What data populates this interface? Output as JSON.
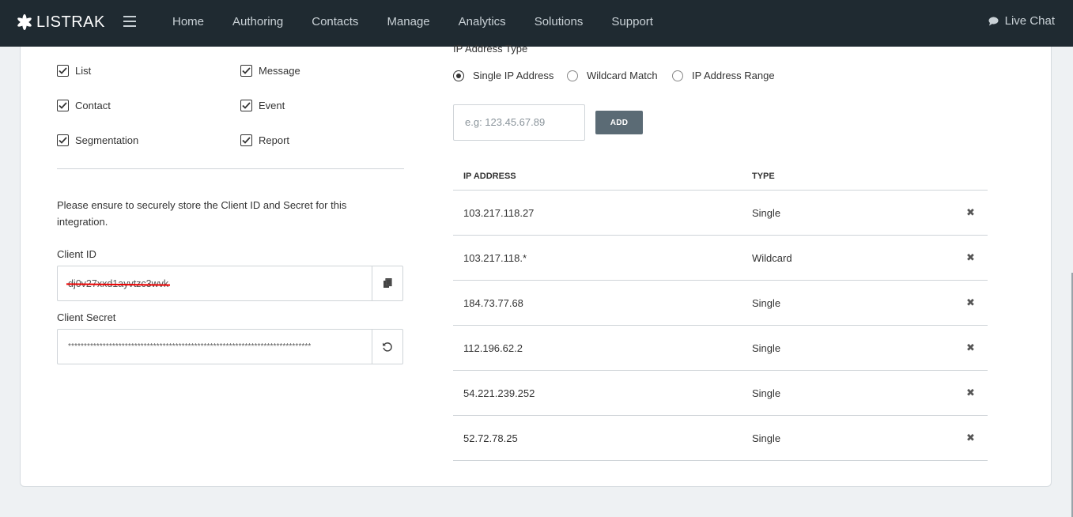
{
  "header": {
    "logo_text": "LISTRAK",
    "nav": [
      "Home",
      "Authoring",
      "Contacts",
      "Manage",
      "Analytics",
      "Solutions",
      "Support"
    ],
    "live_chat": "Live Chat"
  },
  "scopes": [
    {
      "label": "List",
      "checked": true
    },
    {
      "label": "Message",
      "checked": true
    },
    {
      "label": "Contact",
      "checked": true
    },
    {
      "label": "Event",
      "checked": true
    },
    {
      "label": "Segmentation",
      "checked": true
    },
    {
      "label": "Report",
      "checked": true
    }
  ],
  "notice": "Please ensure to securely store the Client ID and Secret for this integration.",
  "client_id": {
    "label": "Client ID",
    "value": "dj0v27xxd1ayvtzc3wvk"
  },
  "client_secret": {
    "label": "Client Secret",
    "value": "*****************************************************************************"
  },
  "ip": {
    "type_label": "IP Address Type",
    "options": [
      {
        "label": "Single IP Address",
        "selected": true
      },
      {
        "label": "Wildcard Match",
        "selected": false
      },
      {
        "label": "IP Address Range",
        "selected": false
      }
    ],
    "input_placeholder": "e.g: 123.45.67.89",
    "add_label": "ADD",
    "columns": [
      "IP ADDRESS",
      "TYPE"
    ],
    "rows": [
      {
        "address": "103.217.118.27",
        "type": "Single"
      },
      {
        "address": "103.217.118.*",
        "type": "Wildcard"
      },
      {
        "address": "184.73.77.68",
        "type": "Single"
      },
      {
        "address": "112.196.62.2",
        "type": "Single"
      },
      {
        "address": "54.221.239.252",
        "type": "Single"
      },
      {
        "address": "52.72.78.25",
        "type": "Single"
      }
    ]
  },
  "colors": {
    "header_bg": "#1f2a31",
    "button_bg": "#5b6b75",
    "page_bg": "#eef1f3",
    "redaction": "#ee0000"
  }
}
